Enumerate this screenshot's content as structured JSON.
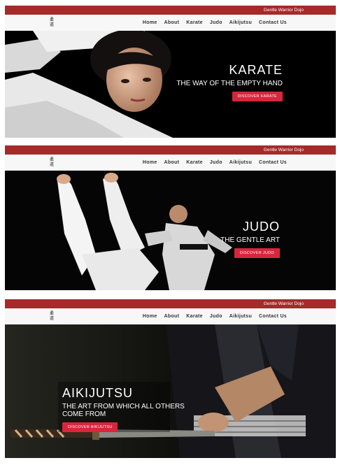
{
  "site_name": "Gentle Warrior Dojo",
  "logo_glyphs": [
    "柔",
    "道"
  ],
  "nav": [
    "Home",
    "About",
    "Karate",
    "Judo",
    "Aikijutsu",
    "Contact Us"
  ],
  "colors": {
    "topbar": "#a52a2a",
    "button": "#d7263d",
    "nav_bg": "#f7f7f7"
  },
  "slides": [
    {
      "title": "KARATE",
      "subtitle": "THE WAY OF THE EMPTY HAND",
      "button": "DISCOVER KARATE",
      "image": "karate-woman-photo"
    },
    {
      "title": "JUDO",
      "subtitle": "THE GENTLE ART",
      "button": "DISCOVER JUDO",
      "image": "judo-throw-photo"
    },
    {
      "title": "AIKIJUTSU",
      "subtitle": "THE ART FROM WHICH ALL OTHERS COME FROM",
      "button": "DISCOVER AIKIJUTSU",
      "image": "katana-photo"
    }
  ]
}
